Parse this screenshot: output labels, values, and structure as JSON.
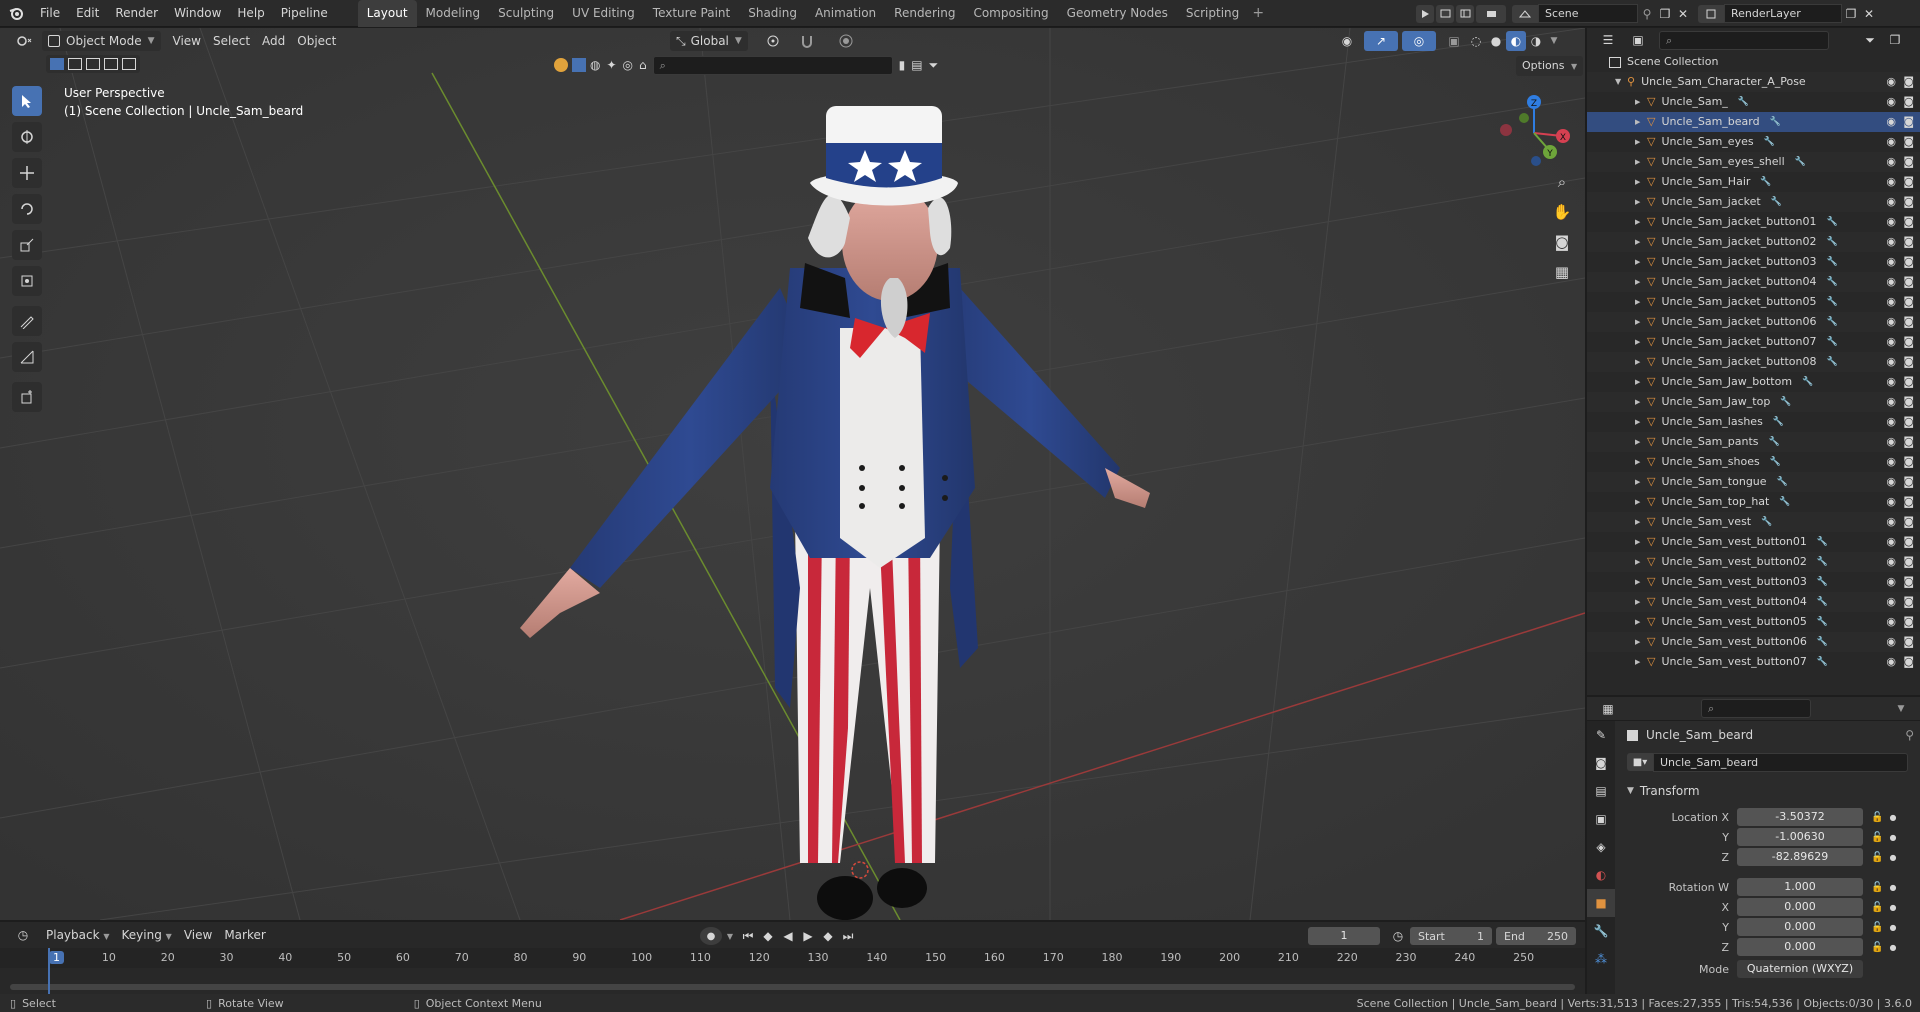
{
  "menu": {
    "items": [
      "File",
      "Edit",
      "Render",
      "Window",
      "Help",
      "Pipeline"
    ]
  },
  "workspaces": [
    "Layout",
    "Modeling",
    "Sculpting",
    "UV Editing",
    "Texture Paint",
    "Shading",
    "Animation",
    "Rendering",
    "Compositing",
    "Geometry Nodes",
    "Scripting"
  ],
  "topbar_right": {
    "scene": "Scene",
    "view_layer": "RenderLayer"
  },
  "viewport": {
    "mode": "Object Mode",
    "menus": [
      "View",
      "Select",
      "Add",
      "Object"
    ],
    "orientation": "Global",
    "options": "Options",
    "info_line1": "User Perspective",
    "info_line2": "(1) Scene Collection | Uncle_Sam_beard"
  },
  "outliner": {
    "root": "Scene Collection",
    "parent": "Uncle_Sam_Character_A_Pose",
    "items": [
      "Uncle_Sam_",
      "Uncle_Sam_beard",
      "Uncle_Sam_eyes",
      "Uncle_Sam_eyes_shell",
      "Uncle_Sam_Hair",
      "Uncle_Sam_jacket",
      "Uncle_Sam_jacket_button01",
      "Uncle_Sam_jacket_button02",
      "Uncle_Sam_jacket_button03",
      "Uncle_Sam_jacket_button04",
      "Uncle_Sam_jacket_button05",
      "Uncle_Sam_jacket_button06",
      "Uncle_Sam_jacket_button07",
      "Uncle_Sam_jacket_button08",
      "Uncle_Sam_Jaw_bottom",
      "Uncle_Sam_Jaw_top",
      "Uncle_Sam_lashes",
      "Uncle_Sam_pants",
      "Uncle_Sam_shoes",
      "Uncle_Sam_tongue",
      "Uncle_Sam_top_hat",
      "Uncle_Sam_vest",
      "Uncle_Sam_vest_button01",
      "Uncle_Sam_vest_button02",
      "Uncle_Sam_vest_button03",
      "Uncle_Sam_vest_button04",
      "Uncle_Sam_vest_button05",
      "Uncle_Sam_vest_button06",
      "Uncle_Sam_vest_button07"
    ]
  },
  "properties": {
    "object_name": "Uncle_Sam_beard",
    "datablock": "Uncle_Sam_beard",
    "panel": "Transform",
    "location": {
      "label": "Location X",
      "x": "-3.50372",
      "y_label": "Y",
      "y": "-1.00630",
      "z_label": "Z",
      "z": "-82.89629"
    },
    "rotation": {
      "label": "Rotation W",
      "w": "1.000",
      "x_label": "X",
      "x": "0.000",
      "y_label": "Y",
      "y": "0.000",
      "z_label": "Z",
      "z": "0.000"
    },
    "mode_label": "Mode",
    "mode_value": "Quaternion (WXYZ)"
  },
  "timeline": {
    "menus": [
      "Playback",
      "Keying",
      "View",
      "Marker"
    ],
    "current_frame": "1",
    "start_label": "Start",
    "start": "1",
    "end_label": "End",
    "end": "250",
    "ruler": [
      "1",
      "10",
      "20",
      "30",
      "40",
      "50",
      "60",
      "70",
      "80",
      "90",
      "100",
      "110",
      "120",
      "130",
      "140",
      "150",
      "160",
      "170",
      "180",
      "190",
      "200",
      "210",
      "220",
      "230",
      "240",
      "250"
    ]
  },
  "statusbar": {
    "select": "Select",
    "rotate": "Rotate View",
    "context": "Object Context Menu",
    "stats": "Scene Collection | Uncle_Sam_beard | Verts:31,513 | Faces:27,355 | Tris:54,536 | Objects:0/30 | 3.6.0"
  }
}
